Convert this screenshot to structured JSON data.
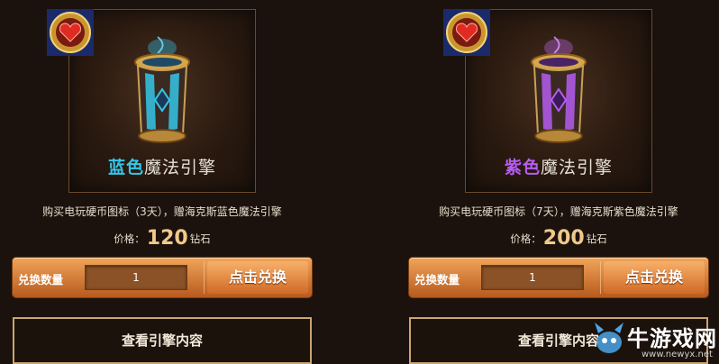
{
  "cards": [
    {
      "title_color_word": "蓝色",
      "title_rest": "魔法引擎",
      "description": "购买电玩硬币图标（3天），赠海克斯蓝色魔法引擎",
      "price_label": "价格：",
      "price_value": "120",
      "price_unit": "钻石",
      "qty_label": "兑换数量",
      "qty_value": "1",
      "redeem_label": "点击兑换",
      "view_label": "查看引擎内容",
      "accent": "#35c6e8",
      "glow": "#34d0ff",
      "icon": "heart-coin-badge-icon"
    },
    {
      "title_color_word": "紫色",
      "title_rest": "魔法引擎",
      "description": "购买电玩硬币图标（7天），赠海克斯紫色魔法引擎",
      "price_label": "价格：",
      "price_value": "200",
      "price_unit": "钻石",
      "qty_label": "兑换数量",
      "qty_value": "1",
      "redeem_label": "点击兑换",
      "view_label": "查看引擎内容",
      "accent": "#b65cf0",
      "glow": "#c86bff",
      "icon": "heart-coin-badge-icon"
    }
  ],
  "watermark": {
    "text": "牛游戏网",
    "url": "www.newyx.net"
  }
}
